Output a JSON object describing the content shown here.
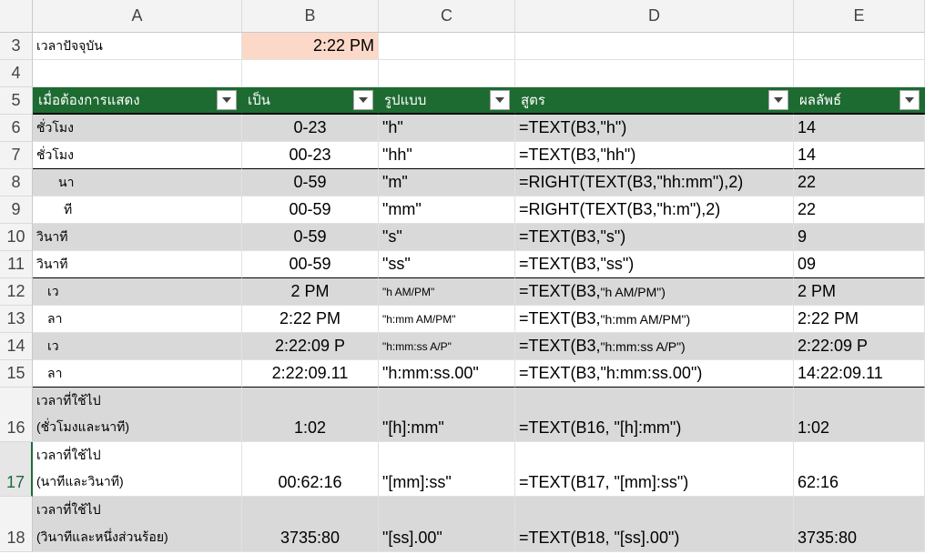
{
  "columns": [
    "A",
    "B",
    "C",
    "D",
    "E"
  ],
  "rows": {
    "r3": {
      "num": "3",
      "a": "เวลาปัจจุบัน",
      "b": "2:22 PM"
    },
    "r4": {
      "num": "4"
    },
    "r5": {
      "num": "5",
      "h1": "เมื่อต้องการแสดง",
      "h2": "เป็น",
      "h3": "รูปแบบ",
      "h4": "สูตร",
      "h5": "ผลลัพธ์"
    },
    "r6": {
      "num": "6",
      "a": "ชั่วโมง",
      "b": "0-23",
      "c": "\"h\"",
      "d": "=TEXT(B3,\"h\")",
      "e": "14"
    },
    "r7": {
      "num": "7",
      "a": "ชั่วโมง",
      "b": "00-23",
      "c": "\"hh\"",
      "d": "=TEXT(B3,\"hh\")",
      "e": "14"
    },
    "r8": {
      "num": "8",
      "a": "นา",
      "b": "0-59",
      "c": "\"m\"",
      "d": "=RIGHT(TEXT(B3,\"hh:mm\"),2)",
      "e": "22"
    },
    "r9": {
      "num": "9",
      "a": "ที",
      "b": "00-59",
      "c": "\"mm\"",
      "d": "=RIGHT(TEXT(B3,\"h:m\"),2)",
      "e": "22"
    },
    "r10": {
      "num": "10",
      "a": "วินาที",
      "b": "0-59",
      "c": "\"s\"",
      "d": "=TEXT(B3,\"s\")",
      "e": "9"
    },
    "r11": {
      "num": "11",
      "a": "วินาที",
      "b": "00-59",
      "c": "\"ss\"",
      "d": "=TEXT(B3,\"ss\")",
      "e": "09"
    },
    "r12": {
      "num": "12",
      "a": "เว",
      "b": "2 PM",
      "c": "\"h AM/PM\"",
      "d1": "=TEXT(B3,",
      "d2": "\"h AM/PM\")",
      "e": "2 PM"
    },
    "r13": {
      "num": "13",
      "a": "ลา",
      "b": "2:22 PM",
      "c": "\"h:mm AM/PM\"",
      "d1": "=TEXT(B3,",
      "d2": "\"h:mm AM/PM\")",
      "e": "2:22 PM"
    },
    "r14": {
      "num": "14",
      "a": "เว",
      "b": "2:22:09 P",
      "c": "\"h:mm:ss A/P\"",
      "d1": "=TEXT(B3,",
      "d2": "\"h:mm:ss A/P\")",
      "e": "2:22:09 P"
    },
    "r15": {
      "num": "15",
      "a": "ลา",
      "b": "2:22:09.11",
      "c": "\"h:mm:ss.00\"",
      "d": "=TEXT(B3,\"h:mm:ss.00\")",
      "e": "14:22:09.11"
    },
    "r16": {
      "num": "16",
      "a1": "เวลาที่ใช้ไป",
      "a2": "(ชั่วโมงและนาที)",
      "b": "1:02",
      "c": "\"[h]:mm\"",
      "d": "=TEXT(B16, \"[h]:mm\")",
      "e": "1:02"
    },
    "r17": {
      "num": "17",
      "a1": "เวลาที่ใช้ไป",
      "a2": "(นาทีและวินาที)",
      "b": "00:62:16",
      "c": "\"[mm]:ss\"",
      "d": "=TEXT(B17, \"[mm]:ss\")",
      "e": "62:16"
    },
    "r18": {
      "num": "18",
      "a1": "เวลาที่ใช้ไป",
      "a2": "(วินาทีและหนึ่งส่วนร้อย)",
      "b": "3735:80",
      "c": "\"[ss].00\"",
      "d": "=TEXT(B18, \"[ss].00\")",
      "e": "3735:80"
    }
  },
  "colors": {
    "header_bg": "#1e6b32",
    "band_gray": "#d9d9d9",
    "input_cell": "#fbd8c8",
    "selected_row": "#1d6b3a"
  },
  "icons": {
    "filter": "filter-dropdown-icon"
  }
}
